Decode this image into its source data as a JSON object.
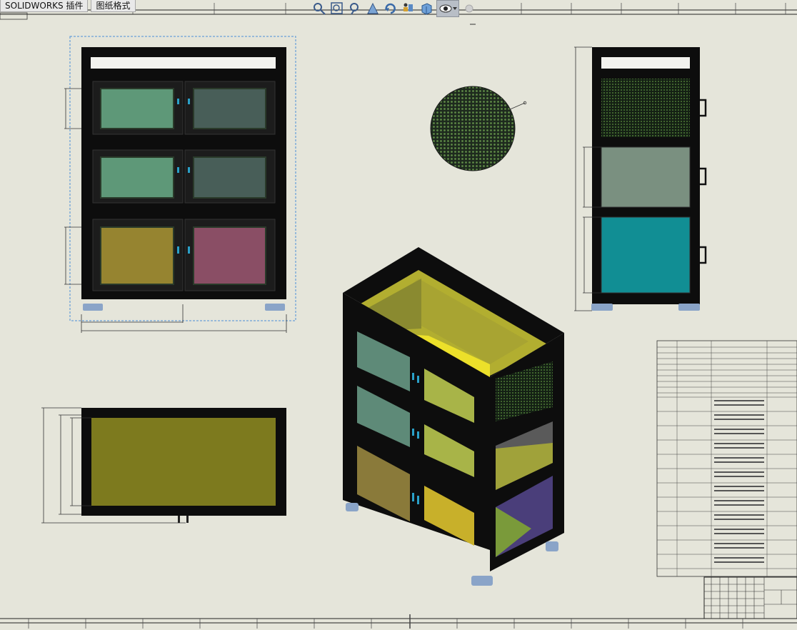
{
  "tabs": [
    {
      "label": "SOLIDWORKS 插件"
    },
    {
      "label": "图纸格式"
    }
  ],
  "toolbar": [
    {
      "icon": "zoom-to-fit-icon"
    },
    {
      "icon": "zoom-to-area-icon"
    },
    {
      "icon": "zoom-in-out-icon"
    },
    {
      "icon": "pan-icon"
    },
    {
      "icon": "rotate-icon"
    },
    {
      "icon": "display-settings-icon"
    },
    {
      "icon": "view-orientation-icon"
    },
    {
      "icon": "hide-show-icon"
    }
  ],
  "colors": {
    "sheet": "#e5e5da",
    "frame": "#111111",
    "glass_green": "#5e9878",
    "glass_dark": "#485e58",
    "glass_gold": "#968430",
    "glass_pink": "#8a4e65",
    "glass_grey_green": "#7a9080",
    "glass_teal": "#118e94",
    "glass_olive": "#7d7a1e",
    "mesh": "#36562e",
    "glass_yellow": "#ece02a",
    "glass_purple": "#4a3e7a",
    "foot": "#8aa4c8"
  }
}
